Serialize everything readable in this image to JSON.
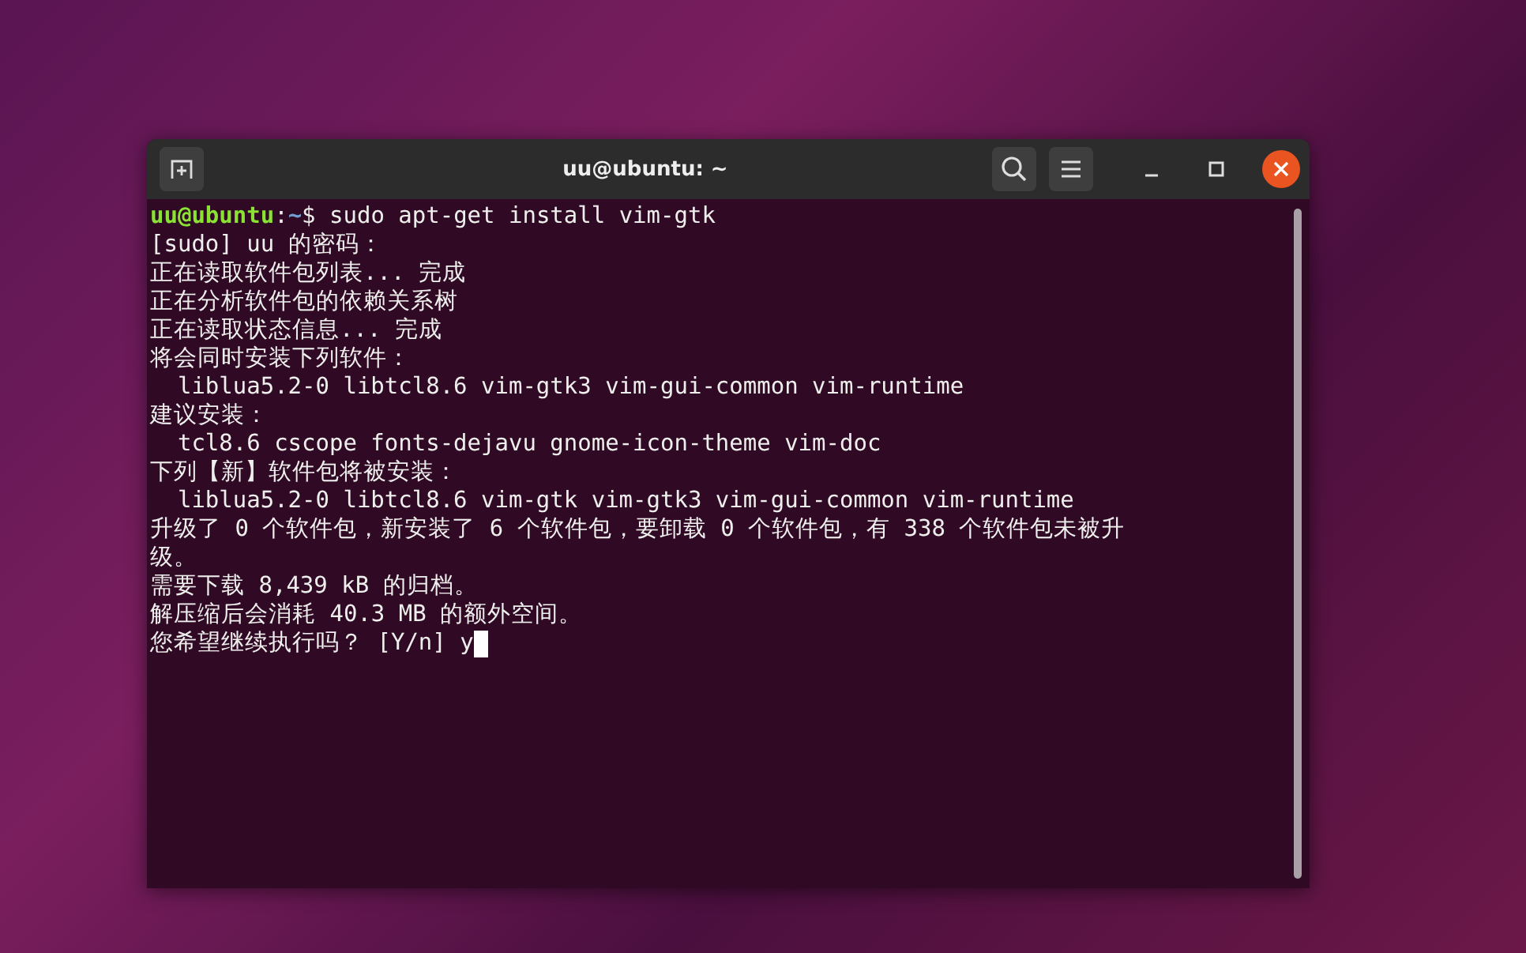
{
  "window": {
    "title": "uu@ubuntu: ~"
  },
  "terminal": {
    "lines": [
      {
        "kind": "prompt",
        "user": "uu@ubuntu",
        "sep": ":",
        "path": "~",
        "command": "$ sudo apt-get install vim-gtk"
      },
      {
        "kind": "output",
        "text": "[sudo] uu 的密码："
      },
      {
        "kind": "output",
        "text": "正在读取软件包列表... 完成"
      },
      {
        "kind": "output",
        "text": "正在分析软件包的依赖关系树"
      },
      {
        "kind": "output",
        "text": "正在读取状态信息... 完成"
      },
      {
        "kind": "output",
        "text": "将会同时安装下列软件："
      },
      {
        "kind": "output",
        "text": "  liblua5.2-0 libtcl8.6 vim-gtk3 vim-gui-common vim-runtime"
      },
      {
        "kind": "output",
        "text": "建议安装："
      },
      {
        "kind": "output",
        "text": "  tcl8.6 cscope fonts-dejavu gnome-icon-theme vim-doc"
      },
      {
        "kind": "output",
        "text": "下列【新】软件包将被安装："
      },
      {
        "kind": "output",
        "text": "  liblua5.2-0 libtcl8.6 vim-gtk vim-gtk3 vim-gui-common vim-runtime"
      },
      {
        "kind": "output",
        "text": "升级了 0 个软件包，新安装了 6 个软件包，要卸载 0 个软件包，有 338 个软件包未被升"
      },
      {
        "kind": "output",
        "text": "级。"
      },
      {
        "kind": "output",
        "text": "需要下载 8,439 kB 的归档。"
      },
      {
        "kind": "output",
        "text": "解压缩后会消耗 40.3 MB 的额外空间。"
      },
      {
        "kind": "input",
        "text": "您希望继续执行吗？ [Y/n] y"
      }
    ]
  }
}
